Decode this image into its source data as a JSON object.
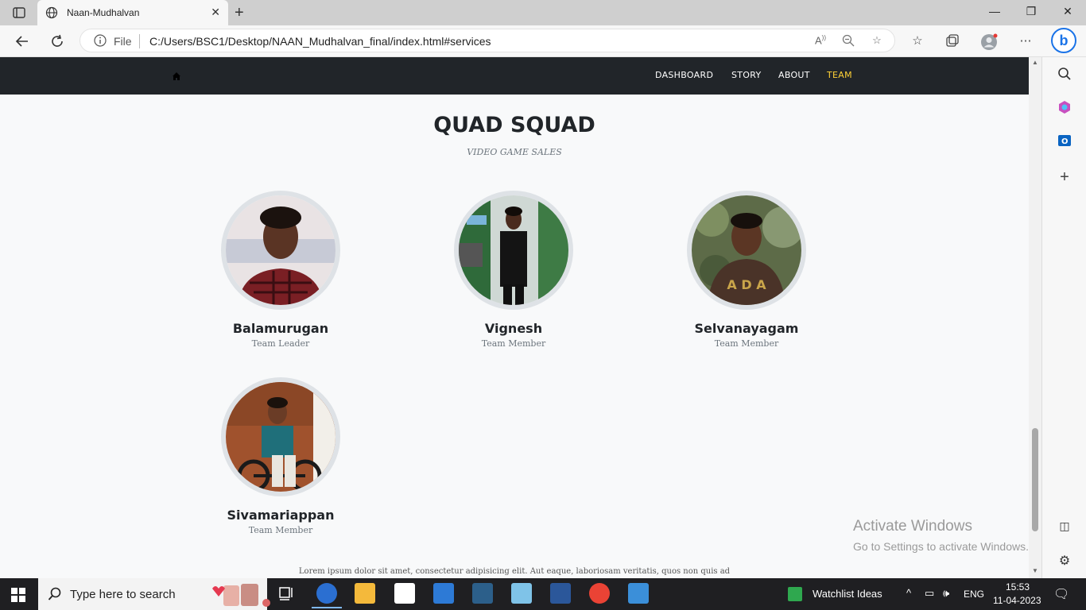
{
  "browser": {
    "tab_title": "Naan-Mudhalvan",
    "address_scheme": "File",
    "address_url": "C:/Users/BSC1/Desktop/NAAN_Mudhalvan_final/index.html#services"
  },
  "site_nav": {
    "links": [
      "DASHBOARD",
      "STORY",
      "ABOUT",
      "TEAM"
    ],
    "active": "TEAM"
  },
  "section": {
    "heading": "QUAD SQUAD",
    "subheading": "VIDEO GAME SALES"
  },
  "team": [
    {
      "name": "Balamurugan",
      "role": "Team Leader"
    },
    {
      "name": "Vignesh",
      "role": "Team Member"
    },
    {
      "name": "Selvanayagam",
      "role": "Team Member"
    },
    {
      "name": "Sivamariappan",
      "role": "Team Member"
    }
  ],
  "footer_text": "Lorem ipsum dolor sit amet, consectetur adipisicing elit. Aut eaque, laboriosam veritatis, quos non quis ad",
  "watermark": {
    "line1": "Activate Windows",
    "line2": "Go to Settings to activate Windows."
  },
  "taskbar": {
    "search_placeholder": "Type here to search",
    "widget_label": "Watchlist Ideas",
    "language": "ENG",
    "time": "15:53",
    "date": "11-04-2023"
  },
  "colors": {
    "nav_bg": "#212529",
    "accent": "#fed136",
    "page_bg": "#f8f9fa"
  }
}
